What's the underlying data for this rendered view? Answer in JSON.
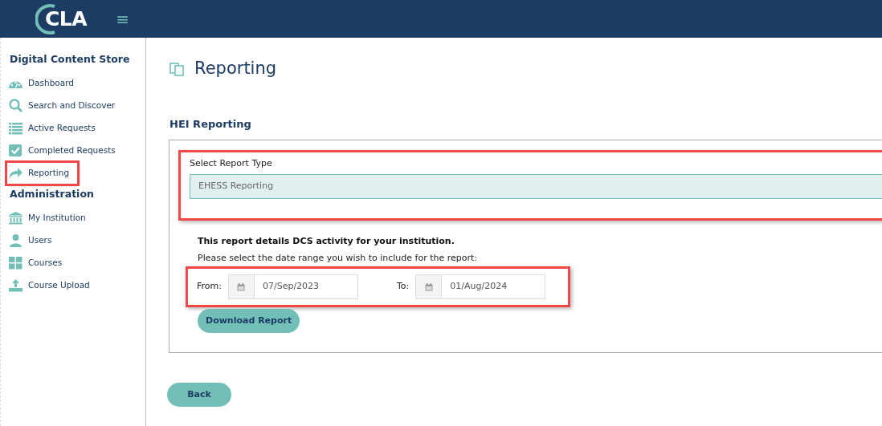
{
  "navbar": {
    "logo": "CLA",
    "menu_toggle": "≡"
  },
  "sidebar": {
    "sections": [
      {
        "title": "Digital Content Store",
        "items": [
          {
            "label": "Dashboard",
            "kind": "gauge",
            "highlighted": false
          },
          {
            "label": "Search and Discover",
            "kind": "search",
            "highlighted": false
          },
          {
            "label": "Active Requests",
            "kind": "list",
            "highlighted": false
          },
          {
            "label": "Completed Requests",
            "kind": "check",
            "highlighted": false
          },
          {
            "label": "Reporting",
            "kind": "share",
            "highlighted": true
          }
        ]
      },
      {
        "title": "Administration",
        "items": [
          {
            "label": "My Institution",
            "kind": "bank",
            "highlighted": false
          },
          {
            "label": "Users",
            "kind": "user",
            "highlighted": false
          },
          {
            "label": "Courses",
            "kind": "grid",
            "highlighted": false
          },
          {
            "label": "Course Upload",
            "kind": "upload",
            "highlighted": false
          }
        ]
      }
    ]
  },
  "page": {
    "title": "Reporting",
    "section_title": "HEI Reporting"
  },
  "report_type": {
    "label": "Select Report Type",
    "value": "EHESS Reporting",
    "highlighted": true
  },
  "description": "This report details DCS activity for your institution.",
  "instruction": "Please select the date range you wish to include for the report:",
  "date_range": {
    "highlighted": true,
    "fields": [
      {
        "label": "From:",
        "value": "07/Sep/2023"
      },
      {
        "label": "To:",
        "value": "01/Aug/2024"
      }
    ]
  },
  "download_button": "Download Report",
  "back_button": "Back"
}
